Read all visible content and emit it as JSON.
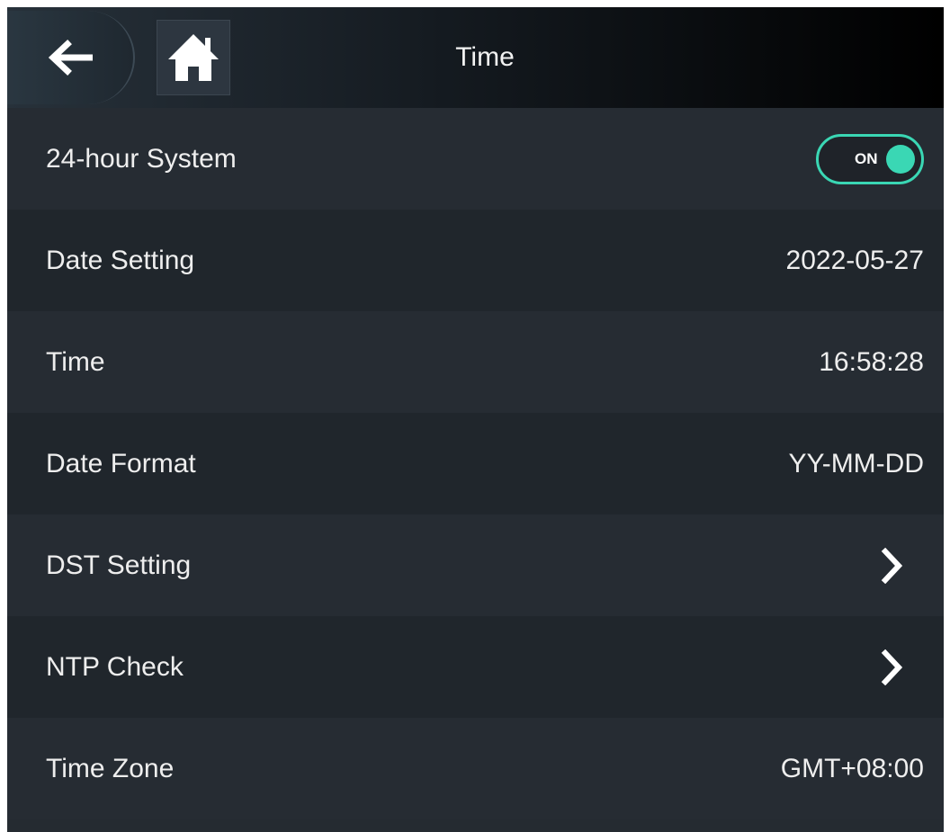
{
  "header": {
    "title": "Time",
    "back_icon": "arrow-left-icon",
    "home_icon": "home-icon"
  },
  "colors": {
    "accent": "#3ad7b4",
    "background": "#252b31",
    "text": "#eeeeee"
  },
  "settings": {
    "hour_system": {
      "label": "24-hour System",
      "toggle_text": "ON",
      "enabled": true
    },
    "date_setting": {
      "label": "Date Setting",
      "value": "2022-05-27"
    },
    "time": {
      "label": "Time",
      "value": "16:58:28"
    },
    "date_format": {
      "label": "Date Format",
      "value": "YY-MM-DD"
    },
    "dst_setting": {
      "label": "DST Setting",
      "icon": "chevron-right-icon"
    },
    "ntp_check": {
      "label": "NTP Check",
      "icon": "chevron-right-icon"
    },
    "time_zone": {
      "label": "Time Zone",
      "value": "GMT+08:00"
    }
  }
}
